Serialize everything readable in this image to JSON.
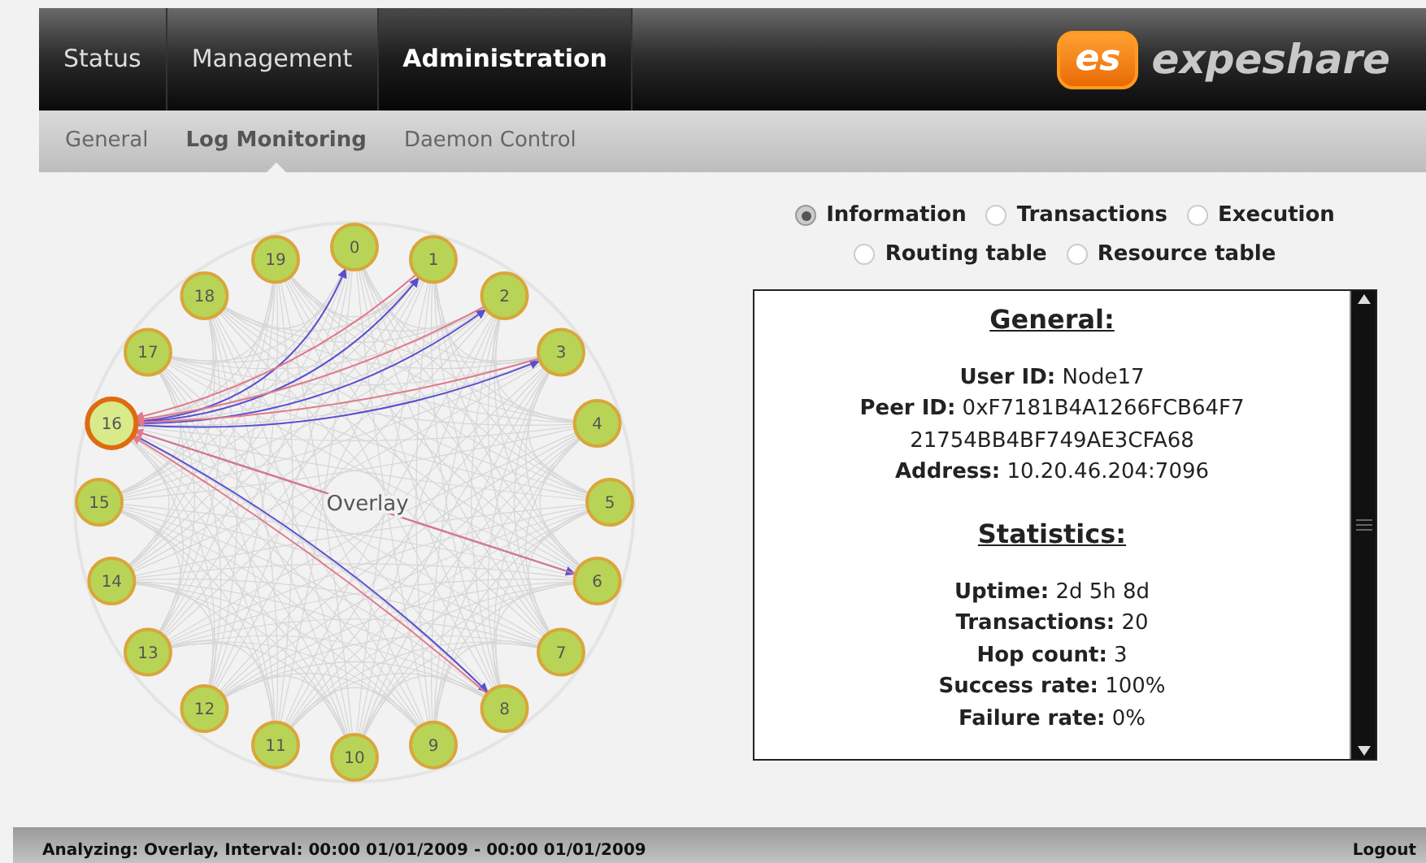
{
  "nav": {
    "tabs": [
      {
        "label": "Status",
        "selected": false
      },
      {
        "label": "Management",
        "selected": false
      },
      {
        "label": "Administration",
        "selected": true
      }
    ],
    "logo": {
      "mark": "es",
      "text": "expeshare"
    }
  },
  "subnav": {
    "tabs": [
      {
        "label": "General",
        "selected": false
      },
      {
        "label": "Log Monitoring",
        "selected": true
      },
      {
        "label": "Daemon Control",
        "selected": false
      }
    ]
  },
  "graph": {
    "label": "Overlay",
    "nodes": [
      {
        "label": "0",
        "selected": false
      },
      {
        "label": "1",
        "selected": false
      },
      {
        "label": "2",
        "selected": false
      },
      {
        "label": "3",
        "selected": false
      },
      {
        "label": "4",
        "selected": false
      },
      {
        "label": "5",
        "selected": false
      },
      {
        "label": "6",
        "selected": false
      },
      {
        "label": "7",
        "selected": false
      },
      {
        "label": "8",
        "selected": false
      },
      {
        "label": "9",
        "selected": false
      },
      {
        "label": "10",
        "selected": false
      },
      {
        "label": "11",
        "selected": false
      },
      {
        "label": "12",
        "selected": false
      },
      {
        "label": "13",
        "selected": false
      },
      {
        "label": "14",
        "selected": false
      },
      {
        "label": "15",
        "selected": false
      },
      {
        "label": "16",
        "selected": true
      },
      {
        "label": "17",
        "selected": false
      },
      {
        "label": "18",
        "selected": false
      },
      {
        "label": "19",
        "selected": false
      }
    ]
  },
  "views": {
    "options": [
      {
        "label": "Information",
        "selected": true
      },
      {
        "label": "Transactions",
        "selected": false
      },
      {
        "label": "Execution",
        "selected": false
      },
      {
        "label": "Routing table",
        "selected": false
      },
      {
        "label": "Resource table",
        "selected": false
      }
    ]
  },
  "info": {
    "sections": [
      {
        "heading": "General:",
        "lines": [
          {
            "label": "User ID:",
            "value": "Node17"
          },
          {
            "label": "Peer ID:",
            "value": "0xF7181B4A1266FCB64F7"
          },
          {
            "value": "21754BB4BF749AE3CFA68"
          },
          {
            "label": "Address:",
            "value": "10.20.46.204:7096"
          }
        ]
      },
      {
        "heading": "Statistics:",
        "lines": [
          {
            "label": "Uptime:",
            "value": "2d 5h 8d"
          },
          {
            "label": "Transactions:",
            "value": "20"
          },
          {
            "label": "Hop count:",
            "value": "3"
          },
          {
            "label": "Success rate:",
            "value": "100%"
          },
          {
            "label": "Failure rate:",
            "value": "0%"
          }
        ]
      }
    ]
  },
  "status_bar": {
    "text": "Analyzing: Overlay, Interval: 00:00 01/01/2009 - 00:00 01/01/2009",
    "logout": "Logout"
  }
}
